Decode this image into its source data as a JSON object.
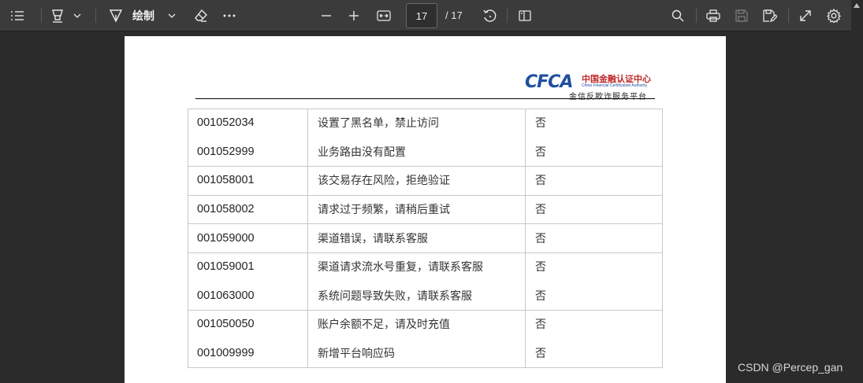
{
  "toolbar": {
    "draw_label": "绘制",
    "page_current": "17",
    "page_total": "/ 17"
  },
  "document": {
    "logo": {
      "brand": "CFCA",
      "name_cn": "中国金融认证中心",
      "name_en": "China Financial Certification Authority",
      "subtitle": "金信反欺诈服务平台"
    },
    "table": {
      "rows": [
        {
          "code": "001052034",
          "desc": "设置了黑名单，禁止访问",
          "flag": "否"
        },
        {
          "code": "001052999",
          "desc": "业务路由没有配置",
          "flag": "否"
        },
        {
          "code": "001058001",
          "desc": "该交易存在风险，拒绝验证",
          "flag": "否"
        },
        {
          "code": "001058002",
          "desc": "请求过于频繁，请稍后重试",
          "flag": "否"
        },
        {
          "code": "001059000",
          "desc": "渠道错误，请联系客服",
          "flag": "否"
        },
        {
          "code": "001059001",
          "desc": "渠道请求流水号重复，请联系客服",
          "flag": "否"
        },
        {
          "code": "001063000",
          "desc": "系统问题导致失败，请联系客服",
          "flag": "否"
        },
        {
          "code": "001050050",
          "desc": "账户余额不足，请及时充值",
          "flag": "否"
        },
        {
          "code": "001009999",
          "desc": "新增平台响应码",
          "flag": "否"
        }
      ]
    }
  },
  "watermark": "CSDN @Percep_gan",
  "colors": {
    "toolbar_bg": "#3b3b3b",
    "viewer_bg": "#2b2b2b",
    "brand_blue": "#1f4fa0",
    "brand_red": "#c0282a"
  }
}
